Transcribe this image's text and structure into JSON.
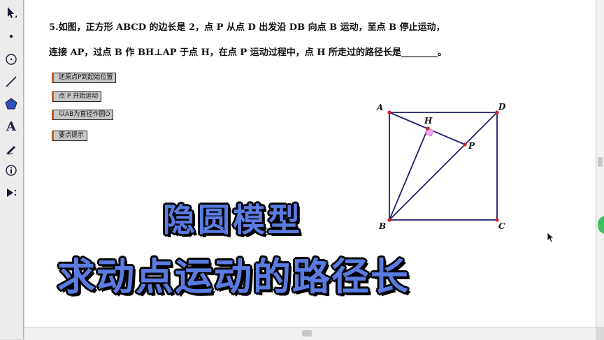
{
  "toolbar": {
    "tools": [
      {
        "name": "arrow-select",
        "interactable": true
      },
      {
        "name": "point",
        "interactable": true
      },
      {
        "name": "compass",
        "interactable": true
      },
      {
        "name": "straightedge",
        "interactable": true
      },
      {
        "name": "polygon",
        "interactable": true
      },
      {
        "name": "text",
        "label": "A",
        "interactable": true
      },
      {
        "name": "marker",
        "interactable": true
      },
      {
        "name": "information",
        "interactable": true
      },
      {
        "name": "custom-tool",
        "interactable": true
      }
    ]
  },
  "problem": {
    "line1": "5.如图，正方形 ABCD 的边长是 2，点 P 从点 D 出发沿 DB 向点 B 运动，至点 B 停止运动，",
    "line2": "连接 AP，过点 B 作 BH⊥AP 于点 H，在点 P 运动过程中，点 H 所走过的路径长是________。"
  },
  "buttons": [
    {
      "label": "还原点P到起始位置"
    },
    {
      "label": "点 P 开始运动"
    },
    {
      "label": "以AB为直径作圆O"
    },
    {
      "label": "要点提示"
    }
  ],
  "diagram": {
    "labels": {
      "A": "A",
      "B": "B",
      "C": "C",
      "D": "D",
      "H": "H",
      "P": "P"
    },
    "colors": {
      "lines": "#1f1f6e",
      "points": "#cc2222",
      "right_angle": "#e070e0"
    }
  },
  "overlay": {
    "line1": "隐圆模型",
    "line2": "求动点运动的路径长",
    "color": "#5a7be0"
  }
}
